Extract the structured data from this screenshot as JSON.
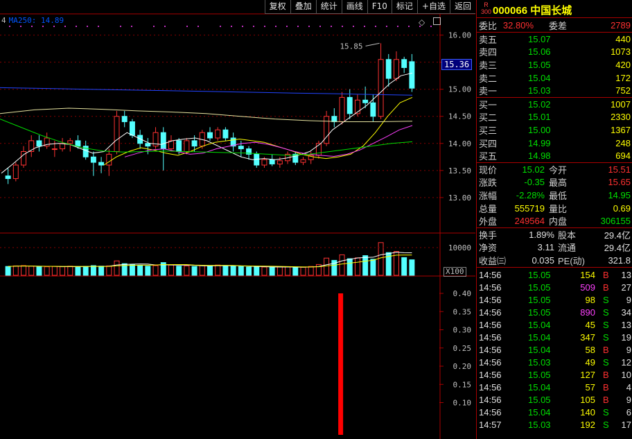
{
  "toolbar": [
    "复权",
    "叠加",
    "统计",
    "画线",
    "F10",
    "标记",
    "+自选",
    "返回"
  ],
  "ma_label": {
    "prefix": "4",
    "text": "MA250: 14.89"
  },
  "price_tag": "15.36",
  "x100": "X100",
  "peak_label": "15.85",
  "stock": {
    "badge_top": "R",
    "badge_bottom": "300",
    "code": "000066",
    "name": "中国长城"
  },
  "weibi": {
    "label": "委比",
    "pct": "32.80%",
    "diff_label": "委差",
    "diff": "2789"
  },
  "asks": [
    {
      "label": "卖五",
      "price": "15.07",
      "vol": "440"
    },
    {
      "label": "卖四",
      "price": "15.06",
      "vol": "1073"
    },
    {
      "label": "卖三",
      "price": "15.05",
      "vol": "420"
    },
    {
      "label": "卖二",
      "price": "15.04",
      "vol": "172"
    },
    {
      "label": "卖一",
      "price": "15.03",
      "vol": "752"
    }
  ],
  "bids": [
    {
      "label": "买一",
      "price": "15.02",
      "vol": "1007"
    },
    {
      "label": "买二",
      "price": "15.01",
      "vol": "2330"
    },
    {
      "label": "买三",
      "price": "15.00",
      "vol": "1367"
    },
    {
      "label": "买四",
      "price": "14.99",
      "vol": "248"
    },
    {
      "label": "买五",
      "price": "14.98",
      "vol": "694"
    }
  ],
  "quote": [
    {
      "l1": "现价",
      "v1": "15.02",
      "c1": "green",
      "l2": "今开",
      "v2": "15.51",
      "c2": "red"
    },
    {
      "l1": "涨跌",
      "v1": "-0.35",
      "c1": "green",
      "l2": "最高",
      "v2": "15.65",
      "c2": "red"
    },
    {
      "l1": "涨幅",
      "v1": "-2.28%",
      "c1": "green",
      "l2": "最低",
      "v2": "14.95",
      "c2": "green"
    },
    {
      "l1": "总量",
      "v1": "555719",
      "c1": "yellow",
      "l2": "量比",
      "v2": "0.69",
      "c2": "yellow"
    },
    {
      "l1": "外盘",
      "v1": "249564",
      "c1": "red",
      "l2": "内盘",
      "v2": "306155",
      "c2": "green"
    }
  ],
  "fund": [
    {
      "l1": "换手",
      "v1": "1.89%",
      "l2": "股本",
      "v2": "29.4亿"
    },
    {
      "l1": "净资",
      "v1": "3.11",
      "l2": "流通",
      "v2": "29.4亿"
    },
    {
      "l1": "收益㈢",
      "v1": "0.035",
      "l2": "PE(动)",
      "v2": "321.8"
    }
  ],
  "trades": [
    {
      "t": "14:56",
      "p": "15.05",
      "v": "154",
      "vc": "yellow",
      "s": "B",
      "n": "13"
    },
    {
      "t": "14:56",
      "p": "15.05",
      "v": "509",
      "vc": "magenta",
      "s": "B",
      "n": "27"
    },
    {
      "t": "14:56",
      "p": "15.05",
      "v": "98",
      "vc": "yellow",
      "s": "S",
      "n": "9"
    },
    {
      "t": "14:56",
      "p": "15.05",
      "v": "890",
      "vc": "magenta",
      "s": "S",
      "n": "34"
    },
    {
      "t": "14:56",
      "p": "15.04",
      "v": "45",
      "vc": "yellow",
      "s": "S",
      "n": "13"
    },
    {
      "t": "14:56",
      "p": "15.04",
      "v": "347",
      "vc": "yellow",
      "s": "S",
      "n": "19"
    },
    {
      "t": "14:56",
      "p": "15.04",
      "v": "58",
      "vc": "yellow",
      "s": "B",
      "n": "9"
    },
    {
      "t": "14:56",
      "p": "15.03",
      "v": "49",
      "vc": "yellow",
      "s": "S",
      "n": "12"
    },
    {
      "t": "14:56",
      "p": "15.05",
      "v": "127",
      "vc": "yellow",
      "s": "B",
      "n": "10"
    },
    {
      "t": "14:56",
      "p": "15.04",
      "v": "57",
      "vc": "yellow",
      "s": "B",
      "n": "4"
    },
    {
      "t": "14:56",
      "p": "15.05",
      "v": "105",
      "vc": "yellow",
      "s": "B",
      "n": "9"
    },
    {
      "t": "14:56",
      "p": "15.04",
      "v": "140",
      "vc": "yellow",
      "s": "S",
      "n": "6"
    },
    {
      "t": "14:57",
      "p": "15.03",
      "v": "192",
      "vc": "yellow",
      "s": "S",
      "n": "17"
    }
  ],
  "chart_data": {
    "type": "candlestick",
    "price_axis": {
      "ticks": [
        16.0,
        15.5,
        15.0,
        14.5,
        14.0,
        13.5,
        13.0
      ],
      "ylim": [
        12.55,
        16.2
      ]
    },
    "volume_axis": {
      "ticks": [
        10000
      ]
    },
    "indicator_axis": {
      "ticks": [
        0.4,
        0.35,
        0.3,
        0.25,
        0.2,
        0.15,
        0.1
      ],
      "ylim": [
        0.0,
        0.44
      ]
    },
    "candles": [
      [
        13.4,
        13.55,
        13.25,
        13.35
      ],
      [
        13.35,
        13.65,
        13.3,
        13.6
      ],
      [
        13.6,
        13.95,
        13.55,
        13.85
      ],
      [
        13.85,
        14.15,
        13.75,
        14.05
      ],
      [
        14.05,
        14.15,
        13.85,
        13.95
      ],
      [
        13.95,
        14.2,
        13.9,
        14.1
      ],
      [
        13.9,
        14.05,
        13.75,
        13.9
      ],
      [
        13.9,
        14.1,
        13.85,
        14.0
      ],
      [
        14.0,
        14.1,
        13.85,
        14.05
      ],
      [
        14.05,
        14.15,
        13.9,
        13.95
      ],
      [
        13.95,
        14.05,
        13.7,
        13.75
      ],
      [
        13.75,
        13.85,
        13.4,
        13.65
      ],
      [
        13.65,
        13.75,
        13.45,
        13.6
      ],
      [
        13.6,
        13.9,
        13.4,
        13.8
      ],
      [
        13.85,
        14.6,
        13.8,
        14.5
      ],
      [
        14.5,
        14.6,
        14.3,
        14.4
      ],
      [
        14.4,
        14.45,
        14.1,
        14.15
      ],
      [
        14.15,
        14.25,
        13.9,
        14.0
      ],
      [
        14.0,
        14.1,
        13.8,
        13.95
      ],
      [
        13.95,
        14.3,
        13.9,
        14.2
      ],
      [
        14.2,
        14.3,
        13.5,
        13.9
      ],
      [
        13.9,
        14.15,
        13.85,
        14.05
      ],
      [
        14.05,
        14.1,
        13.8,
        13.85
      ],
      [
        13.85,
        14.1,
        13.8,
        14.05
      ],
      [
        14.05,
        14.15,
        13.85,
        13.95
      ],
      [
        13.95,
        14.25,
        13.9,
        14.2
      ],
      [
        14.2,
        14.3,
        14.05,
        14.1
      ],
      [
        14.1,
        14.3,
        14.05,
        14.25
      ],
      [
        14.25,
        14.3,
        14.05,
        14.1
      ],
      [
        14.1,
        14.2,
        13.85,
        13.95
      ],
      [
        13.95,
        14.05,
        13.75,
        13.9
      ],
      [
        13.9,
        13.95,
        13.7,
        13.8
      ],
      [
        13.8,
        13.85,
        13.55,
        13.6
      ],
      [
        13.6,
        13.75,
        13.55,
        13.7
      ],
      [
        13.7,
        13.8,
        13.58,
        13.62
      ],
      [
        13.62,
        13.75,
        13.55,
        13.68
      ],
      [
        13.68,
        13.85,
        13.62,
        13.8
      ],
      [
        13.8,
        13.85,
        13.6,
        13.65
      ],
      [
        13.65,
        13.75,
        13.6,
        13.7
      ],
      [
        13.7,
        13.85,
        13.62,
        13.78
      ],
      [
        13.78,
        14.05,
        13.72,
        14.0
      ],
      [
        14.0,
        14.6,
        13.95,
        14.5
      ],
      [
        14.5,
        14.65,
        14.3,
        14.4
      ],
      [
        14.4,
        14.95,
        14.35,
        14.85
      ],
      [
        14.85,
        15.0,
        14.45,
        14.55
      ],
      [
        14.55,
        14.9,
        14.5,
        14.8
      ],
      [
        14.8,
        15.05,
        14.65,
        14.75
      ],
      [
        14.75,
        14.9,
        14.4,
        14.5
      ],
      [
        14.5,
        15.85,
        14.45,
        15.55
      ],
      [
        15.55,
        15.65,
        15.05,
        15.2
      ],
      [
        15.2,
        15.7,
        15.15,
        15.55
      ],
      [
        15.55,
        15.6,
        15.3,
        15.4
      ],
      [
        15.51,
        15.65,
        14.95,
        15.02
      ]
    ],
    "volumes": [
      3200,
      3400,
      3500,
      3300,
      3000,
      3100,
      3200,
      3100,
      3300,
      3000,
      3200,
      3500,
      3300,
      3400,
      5200,
      4200,
      4000,
      3600,
      3300,
      3500,
      4600,
      3700,
      3300,
      3400,
      3200,
      3600,
      3500,
      3700,
      3400,
      3300,
      3200,
      3000,
      3100,
      3000,
      2900,
      3000,
      3100,
      2800,
      2900,
      3200,
      3900,
      6200,
      5400,
      7400,
      6000,
      6300,
      7100,
      5800,
      11800,
      8200,
      8600,
      6400,
      5600
    ],
    "ma_series": [
      {
        "name": "MA250",
        "color": "#2244ff",
        "values": [
          15.03,
          15.02,
          15.01,
          15.0,
          14.99,
          14.98,
          14.97,
          14.96,
          14.95,
          14.94,
          14.93,
          14.92,
          14.91,
          14.9,
          14.89
        ]
      },
      {
        "color": "#ffffff",
        "values": [
          13.45,
          13.62,
          13.8,
          13.92,
          13.98,
          14.0,
          13.98,
          13.9,
          13.82,
          13.85,
          14.05,
          14.2,
          14.1,
          14.0,
          13.98,
          14.05,
          14.08,
          14.1,
          14.05,
          13.95,
          13.85,
          13.75,
          13.7,
          13.72,
          13.7,
          13.73,
          13.78,
          13.85,
          14.0,
          14.25,
          14.4,
          14.55,
          14.7,
          14.9,
          15.1,
          15.25,
          15.3
        ]
      },
      {
        "color": "#ffff00",
        "values": [
          13.6,
          13.75,
          13.85,
          13.92,
          13.88,
          13.82,
          13.78,
          13.85,
          13.95,
          14.02,
          14.05,
          14.08,
          14.05,
          14.02,
          13.95,
          13.88,
          13.8,
          13.75,
          13.72,
          13.75,
          13.8,
          13.95,
          14.2,
          14.5,
          14.75,
          14.85
        ]
      },
      {
        "color": "#ff40ff",
        "values": [
          13.75,
          13.82,
          13.88,
          13.9,
          13.85,
          13.8,
          13.82,
          13.9,
          13.95,
          14.0,
          14.02,
          13.98,
          13.92,
          13.85,
          13.8,
          13.78,
          13.76,
          13.8,
          13.88,
          14.0,
          14.12,
          14.25,
          14.33
        ]
      },
      {
        "color": "#00dd00",
        "values": [
          14.45,
          14.3,
          14.15,
          14.02,
          13.92,
          13.86,
          13.84,
          13.85,
          13.86,
          13.85,
          13.84,
          13.83,
          13.82,
          13.8,
          13.78,
          13.8,
          13.85,
          13.9,
          13.95,
          14.0,
          14.03
        ]
      },
      {
        "color": "#e8e4a0",
        "values": [
          14.55,
          14.62,
          14.65,
          14.63,
          14.6,
          14.58,
          14.55,
          14.5,
          14.45,
          14.42,
          14.4,
          14.4,
          14.41
        ]
      }
    ],
    "indicator_bars": [
      {
        "index": 41,
        "value": 0.4
      }
    ]
  }
}
